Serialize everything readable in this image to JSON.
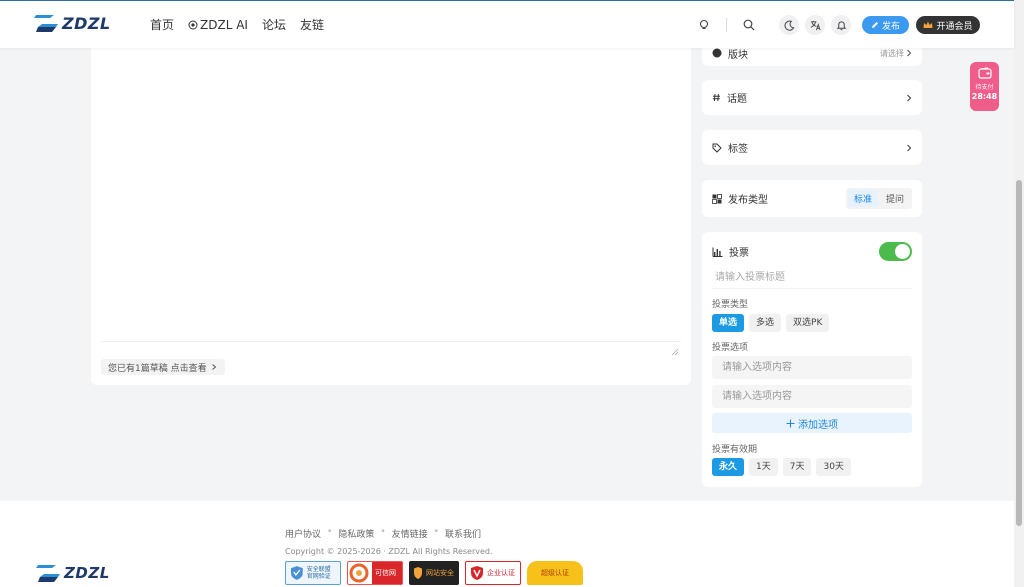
{
  "header": {
    "logo_text": "ZDZL",
    "nav": [
      "首页",
      "ZDZL AI",
      "论坛",
      "友链"
    ],
    "publish_label": "发布",
    "vip_label": "开通会员"
  },
  "editor": {
    "draft_notice": "您已有1篇草稿 点击查看"
  },
  "panel": {
    "section_cut_label": "版块",
    "section_cut_hint": "请选择",
    "topic_label": "话题",
    "tag_label": "标签",
    "publish_type_label": "发布类型",
    "publish_types": [
      "标准",
      "提问"
    ],
    "publish_type_selected": "标准"
  },
  "vote": {
    "label": "投票",
    "enabled": true,
    "title_placeholder": "请输入投票标题",
    "type_label": "投票类型",
    "types": [
      "单选",
      "多选",
      "双选PK"
    ],
    "type_selected": "单选",
    "options_label": "投票选项",
    "option_placeholders": [
      "请输入选项内容",
      "请输入选项内容"
    ],
    "add_option_label": "添加选项",
    "validity_label": "投票有效期",
    "validities": [
      "永久",
      "1天",
      "7天",
      "30天"
    ],
    "validity_selected": "永久"
  },
  "pay_badge": {
    "label": "待支付",
    "timer": "28:48"
  },
  "footer": {
    "links": [
      "用户协议",
      "隐私政策",
      "友情链接",
      "联系我们"
    ],
    "copyright": "Copyright © 2025-2026 · ZDZL All Rights Reserved.",
    "badges": [
      "安全联盟 官网验证",
      "可信网站",
      "网站安全",
      "企业认证",
      "超级认证"
    ],
    "logo_text": "ZDZL"
  },
  "colors": {
    "accent": "#1c9be4",
    "publish_btn": "#3b9af0",
    "toggle_on": "#4cbb4c",
    "pay_badge": "#f15d8a"
  }
}
